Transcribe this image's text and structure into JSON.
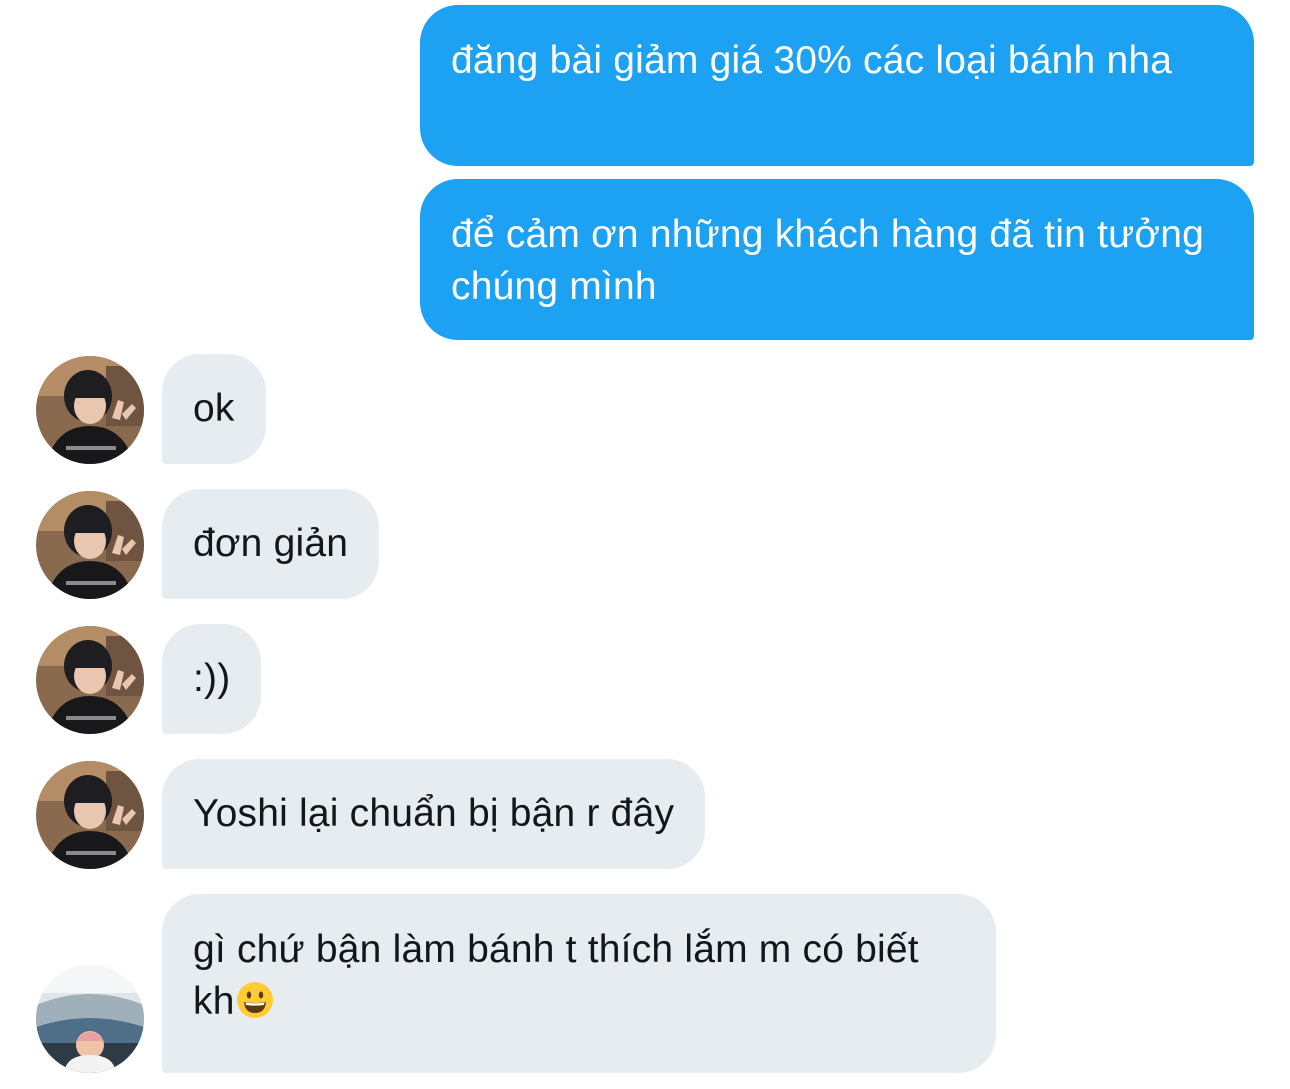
{
  "messages": [
    {
      "direction": "outgoing",
      "text": "đăng bài giảm giá 30% các loại bánh nha"
    },
    {
      "direction": "outgoing",
      "text": "để cảm ơn những khách hàng đã tin tưởng chúng mình"
    },
    {
      "direction": "incoming",
      "text": "ok",
      "avatar": "avatar-person-icon"
    },
    {
      "direction": "incoming",
      "text": "đơn giản",
      "avatar": "avatar-person-icon"
    },
    {
      "direction": "incoming",
      "text": ":))",
      "avatar": "avatar-person-icon"
    },
    {
      "direction": "incoming",
      "text": "Yoshi lại chuẩn bị bận r đây",
      "avatar": "avatar-person-icon"
    },
    {
      "direction": "incoming",
      "text": "gì chứ bận làm bánh t thích lắm m có biết kh",
      "emoji": "grinning-face-emoji",
      "avatar": "avatar-stadium-icon"
    }
  ],
  "colors": {
    "outgoing_bubble": "#1da1f2",
    "incoming_bubble": "#e6ecf0",
    "outgoing_text": "#ffffff",
    "incoming_text": "#14171a"
  }
}
